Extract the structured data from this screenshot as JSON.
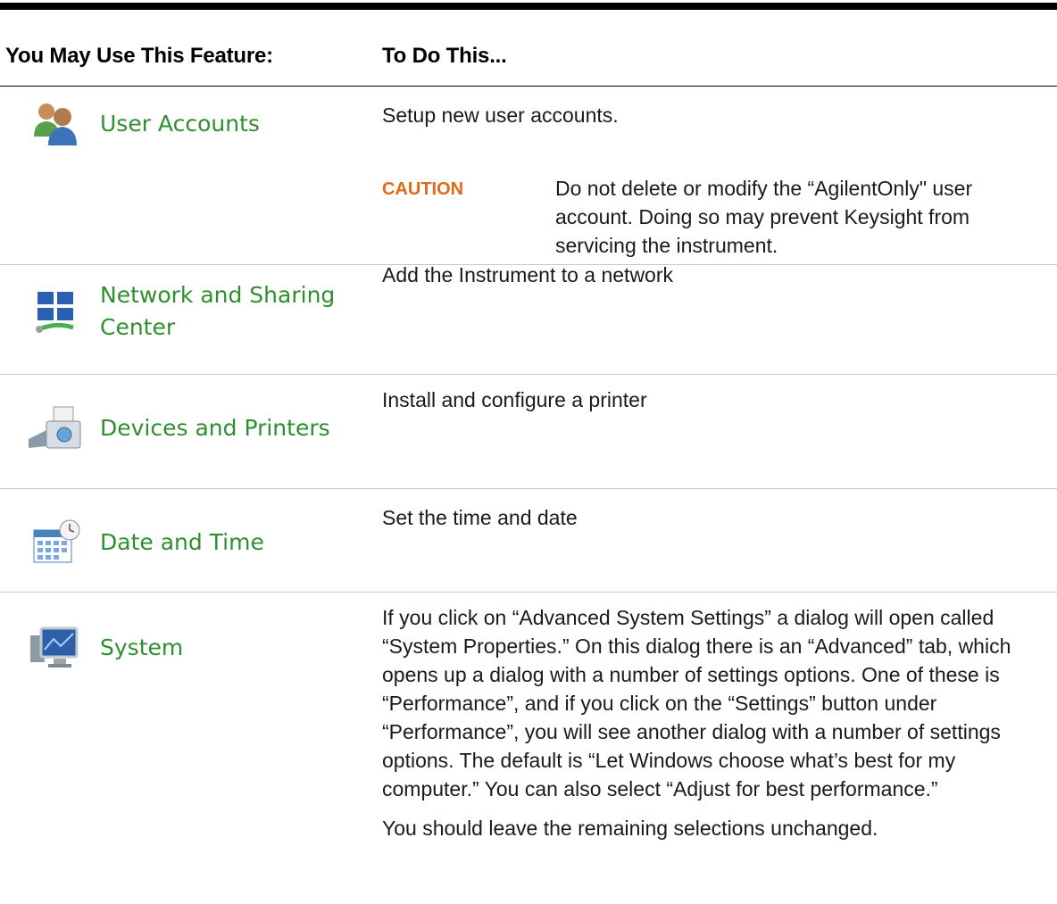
{
  "table": {
    "header": {
      "feature": "You May Use This Feature:",
      "action": "To Do This..."
    },
    "rows": [
      {
        "feature": "User Accounts",
        "icon": "user-accounts-icon",
        "description": "Setup new user accounts.",
        "caution": {
          "label": "CAUTION",
          "text": "Do not delete or modify the “AgilentOnly\" user account. Doing so may prevent Keysight from servicing the instrument."
        }
      },
      {
        "feature_line1": "Network and Sharing",
        "feature_line2": "Center",
        "icon": "network-icon",
        "description": "Add the Instrument to a network"
      },
      {
        "feature": "Devices and Printers",
        "icon": "printer-icon",
        "description": "Install and configure a printer"
      },
      {
        "feature": "Date and Time",
        "icon": "calendar-clock-icon",
        "description": "Set the time and date"
      },
      {
        "feature": "System",
        "icon": "system-monitor-icon",
        "description": "If you click on “Advanced System Settings” a dialog will open called “System Properties.” On this dialog there is an “Advanced” tab, which opens up a dialog with a number of settings options. One of these is “Performance”, and if you click on the “Settings” button under “Performance”, you will see another dialog with a number of settings options.   The default is “Let Windows choose what’s best for my computer.” You can also select “Adjust for best performance.”",
        "note": "You should leave the remaining selections unchanged."
      }
    ]
  },
  "colors": {
    "label_green": "#2f8f2f",
    "caution_orange": "#e06a1c",
    "rule_black": "#000000",
    "row_divider": "#c8c8c8"
  }
}
